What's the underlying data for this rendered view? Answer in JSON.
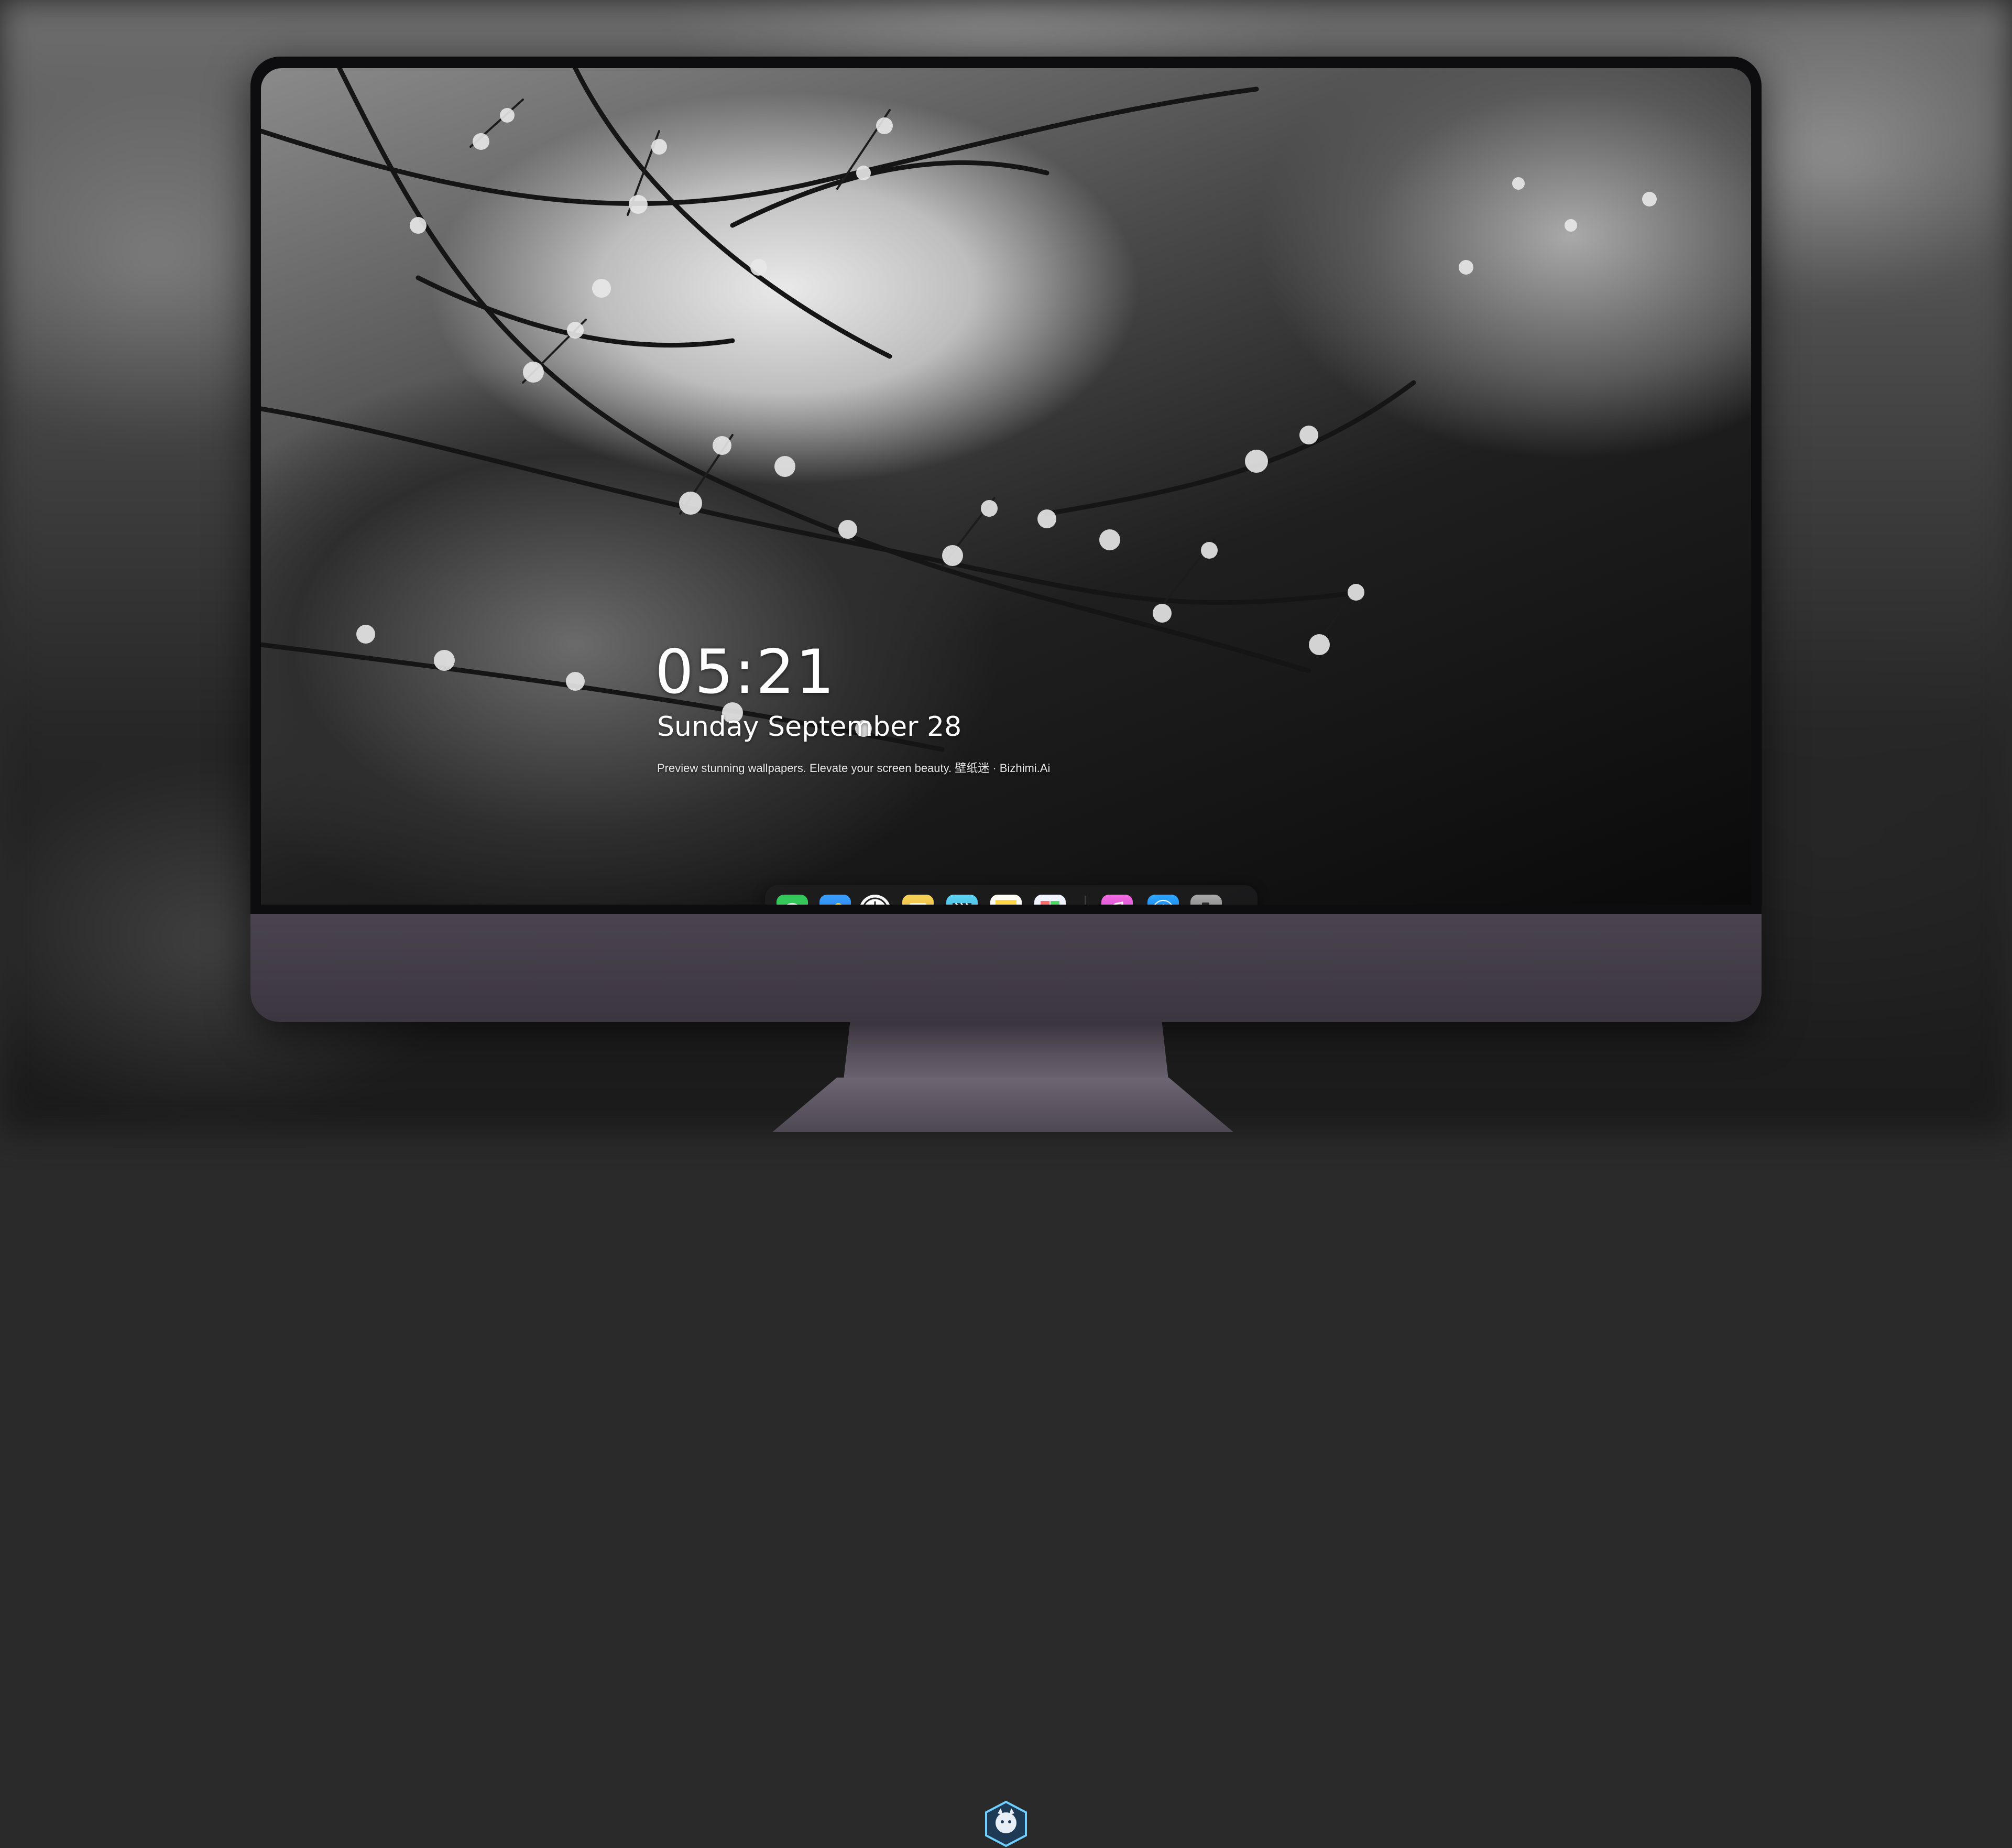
{
  "lockscreen": {
    "time": "05:21",
    "date": "Sunday September  28",
    "tagline": "Preview stunning wallpapers. Elevate your screen beauty. 壁纸迷 · Bizhimi.Ai"
  },
  "dock": {
    "apps": [
      {
        "name": "Messages",
        "icon": "messages-icon",
        "color": "#34c759"
      },
      {
        "name": "Weather",
        "icon": "weather-icon",
        "color": "#2f8cf0"
      },
      {
        "name": "Clock",
        "icon": "clock-icon",
        "color": "#f2f2f2"
      },
      {
        "name": "Preview",
        "icon": "preview-icon",
        "color": "#f4c542"
      },
      {
        "name": "Clips",
        "icon": "clapperboard-icon",
        "color": "#4cc4e8"
      },
      {
        "name": "Notes",
        "icon": "notes-icon",
        "color": "#ffd84a"
      },
      {
        "name": "Photo Booth",
        "icon": "photo-booth-icon",
        "color": "#6b8cff"
      },
      {
        "name": "Music",
        "icon": "music-icon",
        "color": "#ee5ad8"
      },
      {
        "name": "App Store",
        "icon": "app-store-icon",
        "color": "#1a8cff"
      },
      {
        "name": "Camera",
        "icon": "camera-icon",
        "color": "#8a8a8a"
      }
    ]
  },
  "colors": {
    "monitor_bezel": "#0d0d0f",
    "monitor_chin": "#4b4450",
    "dock_bg": "rgba(30,30,32,0.72)"
  }
}
